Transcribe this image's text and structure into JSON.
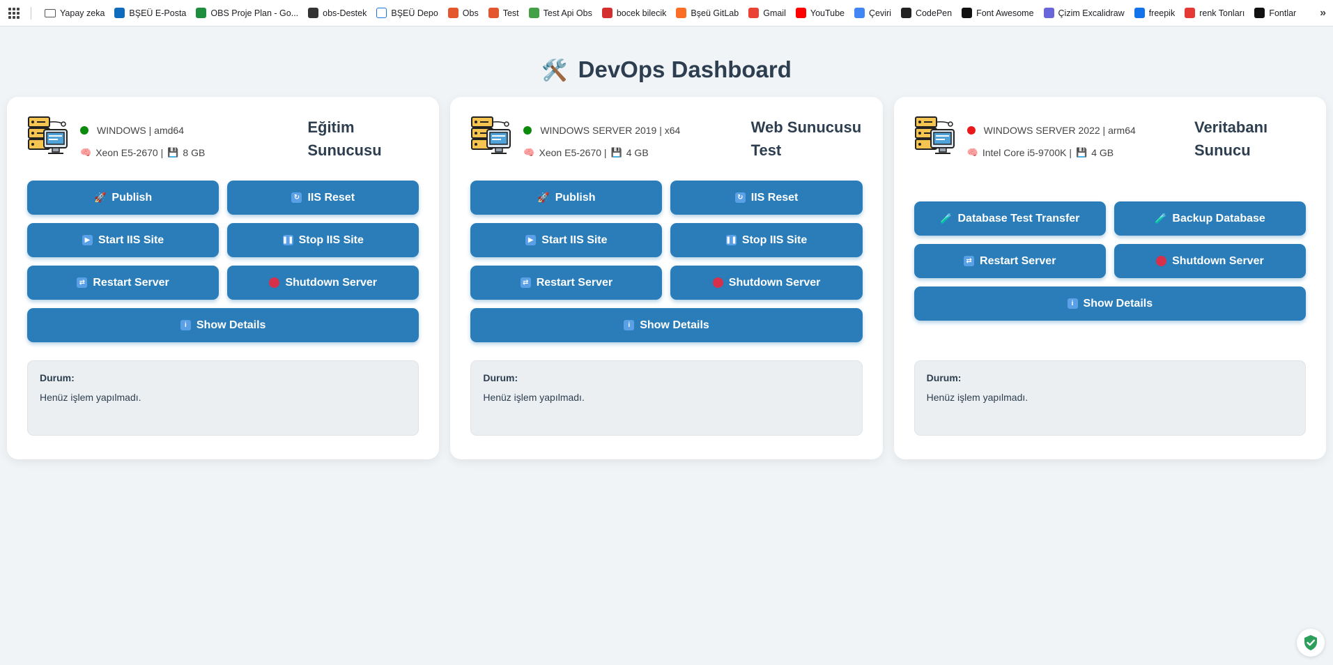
{
  "bookmarks": [
    {
      "label": "Yapay zeka",
      "icon": "folder-icon",
      "color": "#555555"
    },
    {
      "label": "BŞEÜ E-Posta",
      "icon": "outlook-icon",
      "color": "#0f6cbd"
    },
    {
      "label": "OBS Proje Plan - Go...",
      "icon": "sheets-icon",
      "color": "#1e8e3e"
    },
    {
      "label": "obs-Destek",
      "icon": "g-icon",
      "color": "#333333"
    },
    {
      "label": "BŞEÜ Depo",
      "icon": "folder-blue-icon",
      "color": "#1a73e8"
    },
    {
      "label": "Obs",
      "icon": "b-icon",
      "color": "#e4572e"
    },
    {
      "label": "Test",
      "icon": "b-icon",
      "color": "#e4572e"
    },
    {
      "label": "Test Api Obs",
      "icon": "globe-icon",
      "color": "#43a047"
    },
    {
      "label": "bocek bilecik",
      "icon": "arc-icon",
      "color": "#d32f2f"
    },
    {
      "label": "Bşeü GitLab",
      "icon": "gitlab-icon",
      "color": "#fc6d26"
    },
    {
      "label": "Gmail",
      "icon": "gmail-icon",
      "color": "#ea4335"
    },
    {
      "label": "YouTube",
      "icon": "youtube-icon",
      "color": "#ff0000"
    },
    {
      "label": "Çeviri",
      "icon": "translate-icon",
      "color": "#4285f4"
    },
    {
      "label": "CodePen",
      "icon": "codepen-icon",
      "color": "#222222"
    },
    {
      "label": "Font Awesome",
      "icon": "flag-icon",
      "color": "#111111"
    },
    {
      "label": "Çizim Excalidraw",
      "icon": "excalidraw-icon",
      "color": "#6965db"
    },
    {
      "label": "freepik",
      "icon": "freepik-icon",
      "color": "#1273eb"
    },
    {
      "label": "renk Tonları",
      "icon": "pencil-icon",
      "color": "#e53935"
    },
    {
      "label": "Fontlar",
      "icon": "ff-icon",
      "color": "#111111"
    }
  ],
  "bookmarks_more": "»",
  "page": {
    "title_icon": "🛠️",
    "title": "DevOps Dashboard"
  },
  "colors": {
    "button": "#2a7db8",
    "online": "#0c8a0c",
    "offline": "#e8191a"
  },
  "servers": [
    {
      "name_line1": "Eğitim",
      "name_line2": "Sunucusu",
      "status": "online",
      "os": "WINDOWS | amd64",
      "cpu_icon": "🧠",
      "cpu": "Xeon E5-2670 |",
      "ram_icon": "💾",
      "ram": "8 GB",
      "buttons": {
        "publish": "Publish",
        "iis_reset": "IIS Reset",
        "start_iis": "Start IIS Site",
        "stop_iis": "Stop IIS Site",
        "restart": "Restart Server",
        "shutdown": "Shutdown Server",
        "details": "Show Details"
      },
      "status_label": "Durum:",
      "status_text": "Henüz işlem yapılmadı."
    },
    {
      "name_line1": "Web Sunucusu",
      "name_line2": "Test",
      "status": "online",
      "os": "WINDOWS SERVER 2019 | x64",
      "cpu_icon": "🧠",
      "cpu": "Xeon E5-2670 |",
      "ram_icon": "💾",
      "ram": "4 GB",
      "buttons": {
        "publish": "Publish",
        "iis_reset": "IIS Reset",
        "start_iis": "Start IIS Site",
        "stop_iis": "Stop IIS Site",
        "restart": "Restart Server",
        "shutdown": "Shutdown Server",
        "details": "Show Details"
      },
      "status_label": "Durum:",
      "status_text": "Henüz işlem yapılmadı."
    },
    {
      "name_line1": "Veritabanı",
      "name_line2": "Sunucu",
      "status": "offline",
      "os": "WINDOWS SERVER 2022 | arm64",
      "cpu_icon": "🧠",
      "cpu": "Intel Core i5-9700K |",
      "ram_icon": "💾",
      "ram": "4 GB",
      "buttons": {
        "db_transfer": "Database Test Transfer",
        "backup": "Backup Database",
        "restart": "Restart Server",
        "shutdown": "Shutdown Server",
        "details": "Show Details"
      },
      "status_label": "Durum:",
      "status_text": "Henüz işlem yapılmadı."
    }
  ]
}
